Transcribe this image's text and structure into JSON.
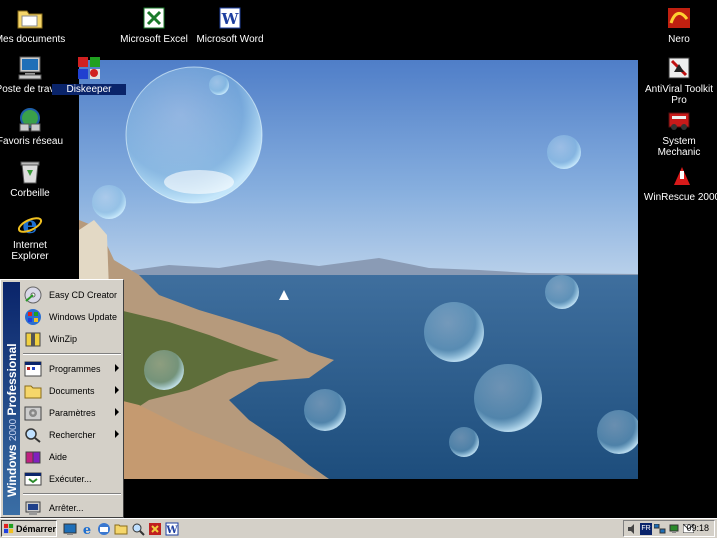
{
  "desktop": {
    "icons": [
      {
        "label": "Mes documents",
        "icon": "folder-icon"
      },
      {
        "label": "Poste de travail",
        "icon": "computer-icon"
      },
      {
        "label": "Favoris réseau",
        "icon": "network-icon"
      },
      {
        "label": "Corbeille",
        "icon": "recycle-bin-icon"
      },
      {
        "label": "Internet Explorer",
        "icon": "ie-icon"
      },
      {
        "label": "Microsoft Excel",
        "icon": "excel-icon"
      },
      {
        "label": "Microsoft Word",
        "icon": "word-icon"
      },
      {
        "label": "Diskeeper",
        "icon": "diskeeper-icon"
      },
      {
        "label": "Nero",
        "icon": "nero-icon"
      },
      {
        "label": "AntiViral Toolkit Pro",
        "icon": "antiviral-icon"
      },
      {
        "label": "System Mechanic",
        "icon": "system-mechanic-icon"
      },
      {
        "label": "WinRescue 2000",
        "icon": "winrescue-icon"
      }
    ]
  },
  "start_menu": {
    "banner_bold": "Windows",
    "banner_version": "2000",
    "banner_edition": "Professional",
    "items": [
      {
        "label": "Easy CD Creator",
        "icon": "cd-creator-icon",
        "submenu": false
      },
      {
        "label": "Windows Update",
        "icon": "windows-update-icon",
        "submenu": false
      },
      {
        "label": "WinZip",
        "icon": "winzip-icon",
        "submenu": false
      },
      {
        "label": "Programmes",
        "icon": "programs-icon",
        "submenu": true
      },
      {
        "label": "Documents",
        "icon": "documents-icon",
        "submenu": true
      },
      {
        "label": "Paramètres",
        "icon": "settings-icon",
        "submenu": true
      },
      {
        "label": "Rechercher",
        "icon": "search-icon",
        "submenu": true
      },
      {
        "label": "Aide",
        "icon": "help-icon",
        "submenu": false
      },
      {
        "label": "Exécuter...",
        "icon": "run-icon",
        "submenu": false
      },
      {
        "label": "Arrêter...",
        "icon": "shutdown-icon",
        "submenu": false
      }
    ]
  },
  "taskbar": {
    "start_label": "Démarrer",
    "quick_launch": [
      "desktop-icon",
      "ie-icon",
      "outlook-icon",
      "explorer-icon",
      "search-icon",
      "media-icon",
      "word-icon"
    ],
    "tray": {
      "icons": [
        "speaker-icon",
        "network-icon",
        "monitor-icon",
        "mail-icon"
      ],
      "language": "FR",
      "clock": "09:18"
    }
  },
  "colors": {
    "desktop": "#000000",
    "menu_face": "#d4d0c8",
    "banner": "#0a246a",
    "selection": "#0a246a"
  }
}
